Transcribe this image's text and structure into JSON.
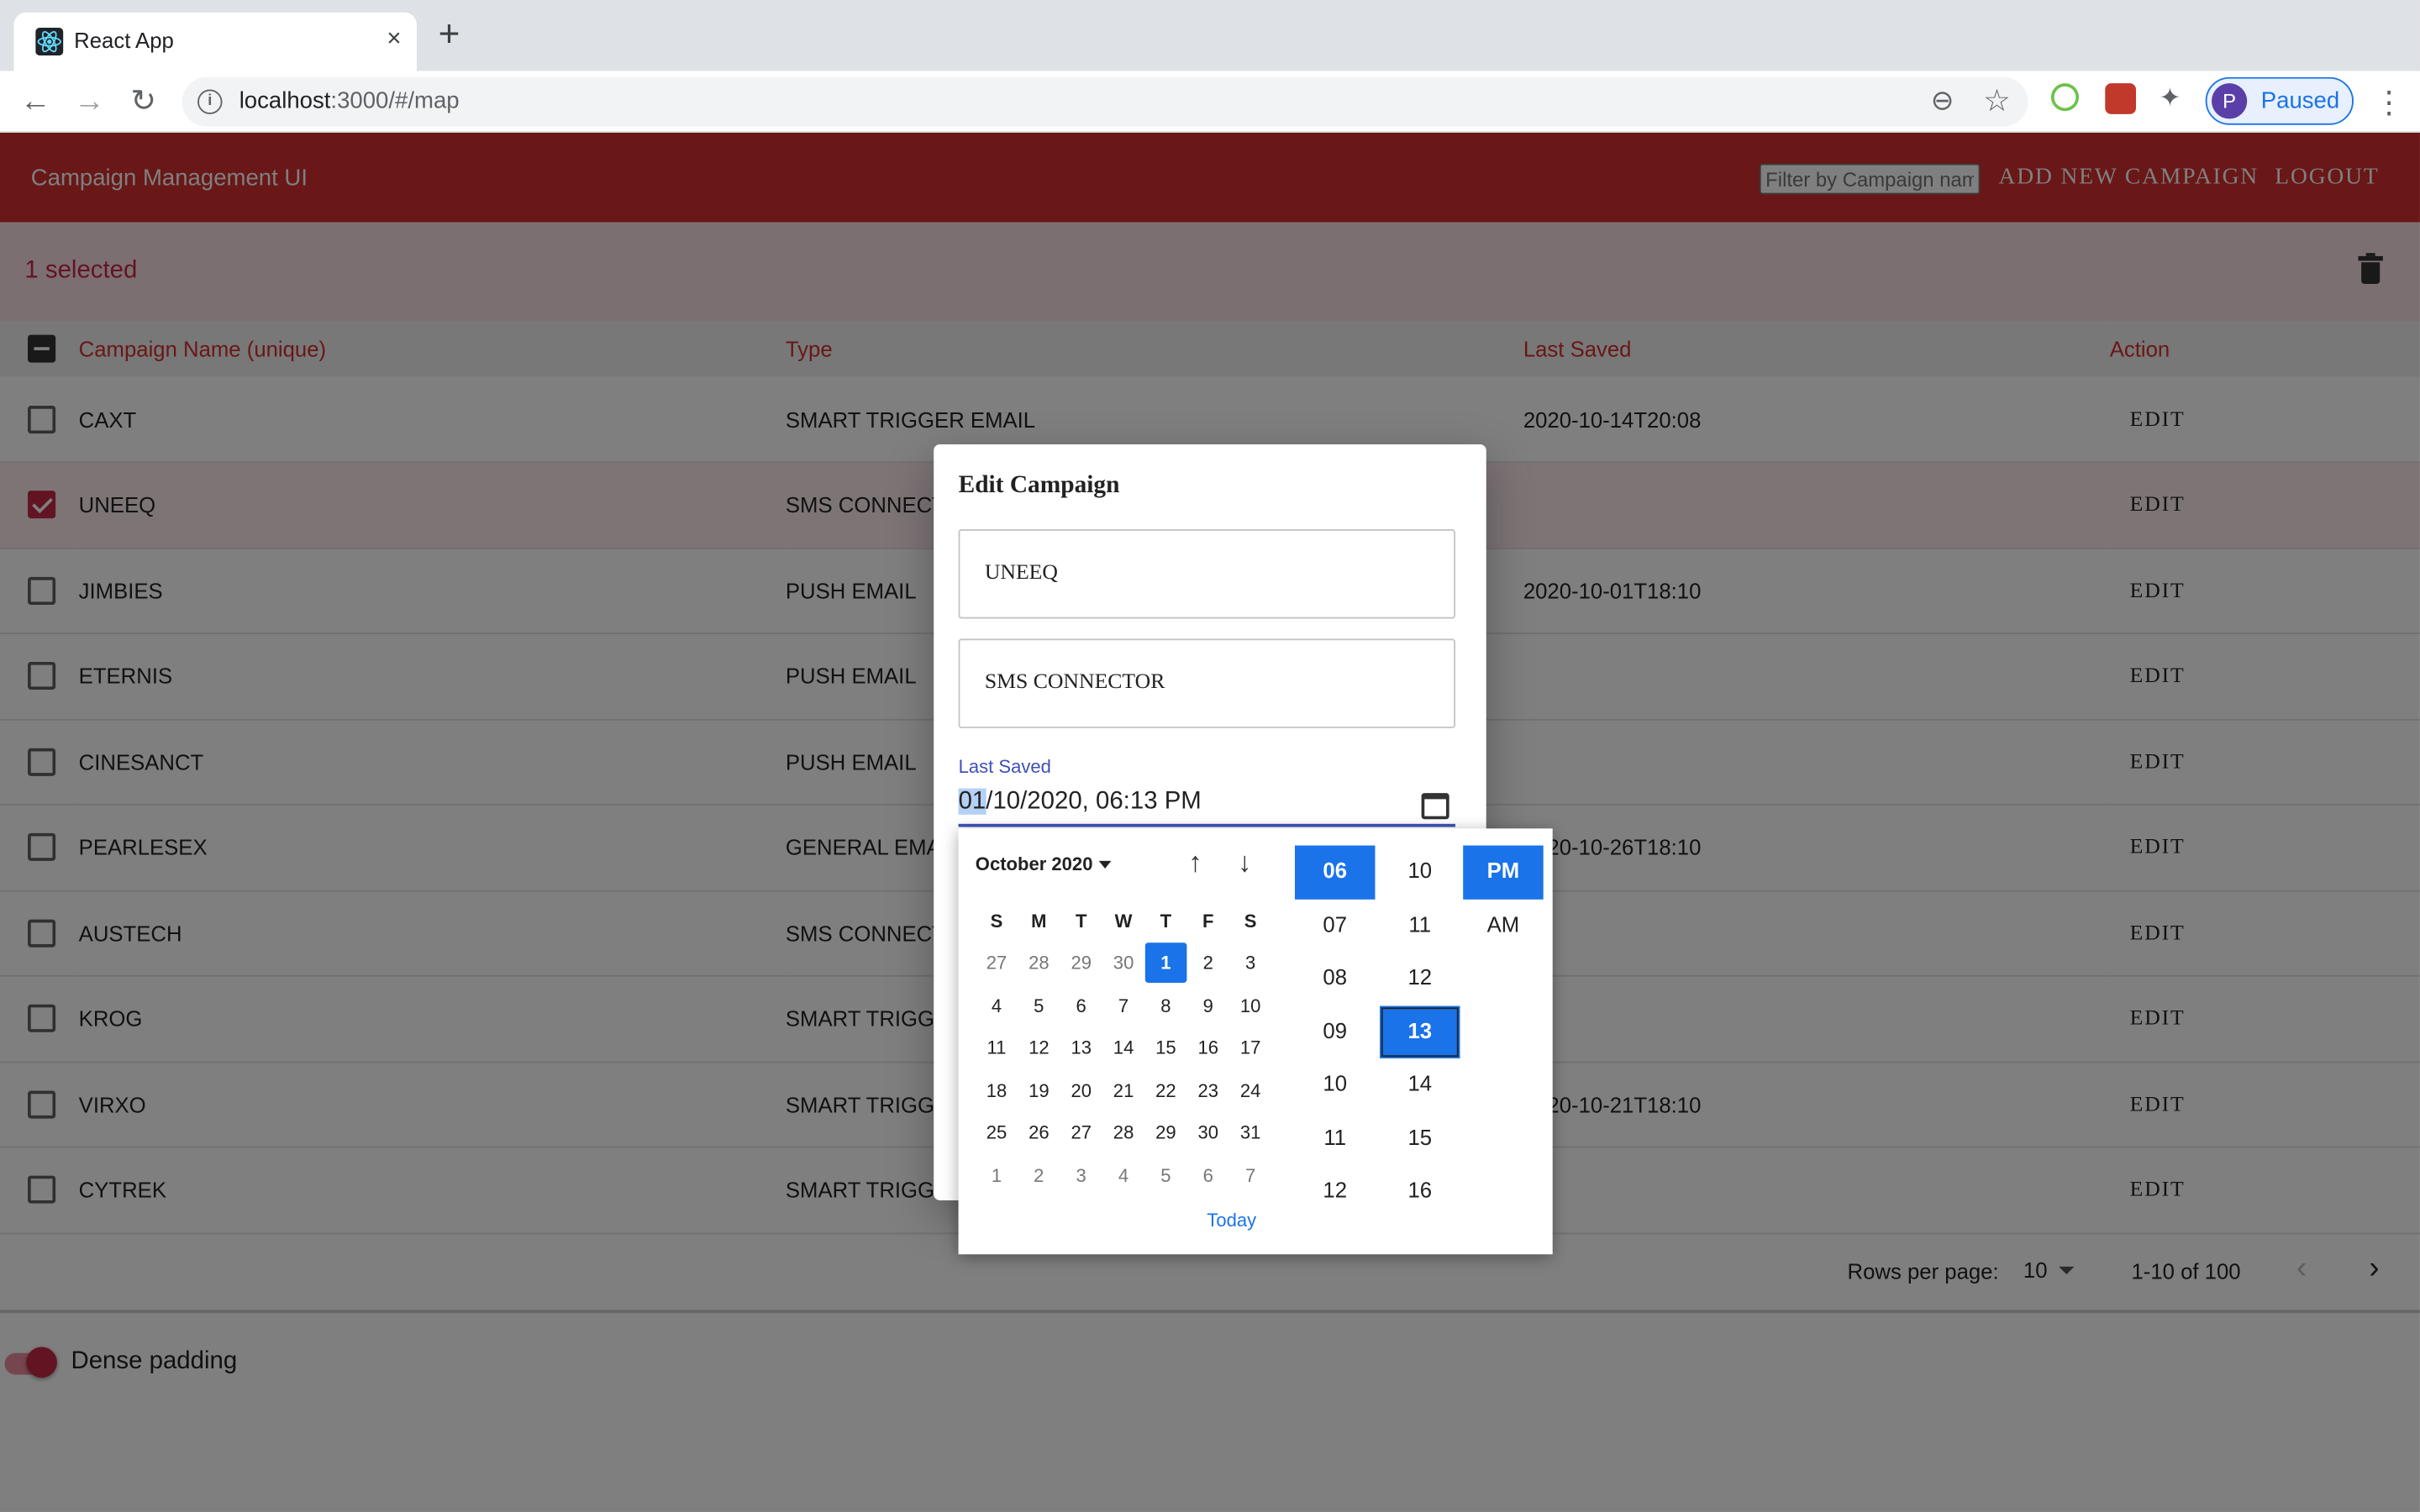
{
  "browser": {
    "tab_title": "React App",
    "tab_close": "×",
    "new_tab": "+",
    "url_host": "localhost",
    "url_path": ":3000/#/map",
    "profile_initial": "P",
    "profile_status": "Paused"
  },
  "app": {
    "title": "Campaign Management UI",
    "filter_placeholder": "Filter by Campaign name",
    "add_button": "ADD NEW CAMPAIGN",
    "logout_button": "LOGOUT",
    "selected_text": "1 selected",
    "columns": [
      "Campaign Name (unique)",
      "Type",
      "Last Saved",
      "Action"
    ],
    "rows": [
      {
        "name": "CAXT",
        "type": "SMART TRIGGER EMAIL",
        "saved": "2020-10-14T20:08",
        "action": "EDIT",
        "checked": false
      },
      {
        "name": "UNEEQ",
        "type": "SMS CONNECTOR",
        "saved": "",
        "action": "EDIT",
        "checked": true
      },
      {
        "name": "JIMBIES",
        "type": "PUSH EMAIL",
        "saved": "2020-10-01T18:10",
        "action": "EDIT",
        "checked": false
      },
      {
        "name": "ETERNIS",
        "type": "PUSH EMAIL",
        "saved": "",
        "action": "EDIT",
        "checked": false
      },
      {
        "name": "CINESANCT",
        "type": "PUSH EMAIL",
        "saved": "",
        "action": "EDIT",
        "checked": false
      },
      {
        "name": "PEARLESEX",
        "type": "GENERAL EMAIL",
        "saved": "2020-10-26T18:10",
        "action": "EDIT",
        "checked": false
      },
      {
        "name": "AUSTECH",
        "type": "SMS CONNECTOR",
        "saved": "",
        "action": "EDIT",
        "checked": false
      },
      {
        "name": "KROG",
        "type": "SMART TRIGGER EMAIL",
        "saved": "",
        "action": "EDIT",
        "checked": false
      },
      {
        "name": "VIRXO",
        "type": "SMART TRIGGER EMAIL",
        "saved": "2020-10-21T18:10",
        "action": "EDIT",
        "checked": false
      },
      {
        "name": "CYTREK",
        "type": "SMART TRIGGER EMAIL",
        "saved": "",
        "action": "EDIT",
        "checked": false
      }
    ],
    "pagination": {
      "rows_per_page_label": "Rows per page:",
      "rows_per_page": "10",
      "range": "1-10 of 100"
    },
    "dense_label": "Dense padding",
    "dense_enabled": true
  },
  "dialog": {
    "title": "Edit Campaign",
    "name_value": "UNEEQ",
    "type_value": "SMS CONNECTOR",
    "last_saved_label": "Last Saved",
    "date_segment_highlight": "01",
    "date_rest": "/10/2020, 06:13 PM"
  },
  "picker": {
    "month_label": "October 2020",
    "weekdays": [
      "S",
      "M",
      "T",
      "W",
      "T",
      "F",
      "S"
    ],
    "weeks": [
      [
        "27",
        "28",
        "29",
        "30",
        "1",
        "2",
        "3"
      ],
      [
        "4",
        "5",
        "6",
        "7",
        "8",
        "9",
        "10"
      ],
      [
        "11",
        "12",
        "13",
        "14",
        "15",
        "16",
        "17"
      ],
      [
        "18",
        "19",
        "20",
        "21",
        "22",
        "23",
        "24"
      ],
      [
        "25",
        "26",
        "27",
        "28",
        "29",
        "30",
        "31"
      ],
      [
        "1",
        "2",
        "3",
        "4",
        "5",
        "6",
        "7"
      ]
    ],
    "selected_day": "1",
    "today_label": "Today",
    "hours": [
      "06",
      "07",
      "08",
      "09",
      "10",
      "11",
      "12"
    ],
    "selected_hour": "06",
    "minutes": [
      "10",
      "11",
      "12",
      "13",
      "14",
      "15",
      "16"
    ],
    "selected_minute": "13",
    "meridiem": [
      "PM",
      "AM"
    ],
    "selected_meridiem": "PM"
  },
  "colors": {
    "appbar": "#d32f2f",
    "accent": "#c62846",
    "picker_selected": "#1a73e8"
  }
}
